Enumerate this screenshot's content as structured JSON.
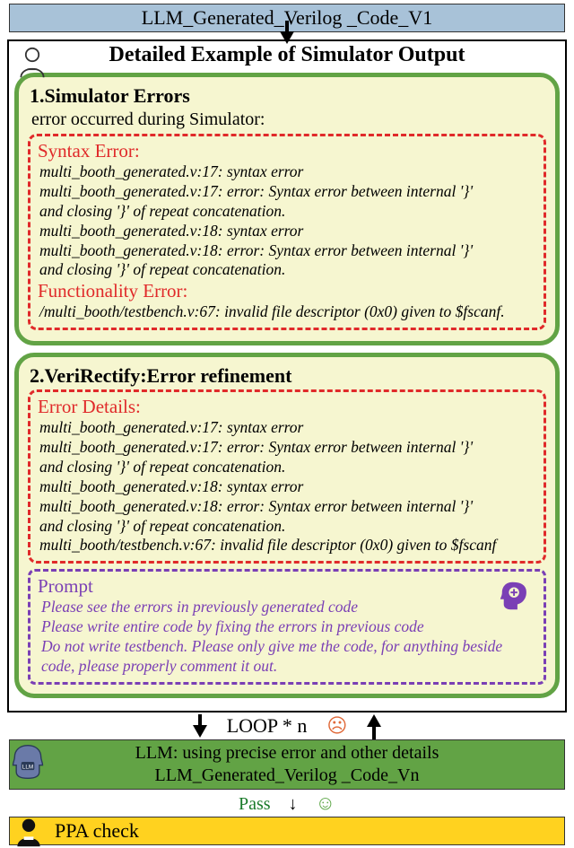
{
  "top_label": "LLM_Generated_Verilog _Code_V1",
  "main_title": "Detailed Example of Simulator Output",
  "box1": {
    "heading": "1.Simulator Errors",
    "sub": "error occurred during Simulator:",
    "syntax_label": "Syntax Error:",
    "syntax_lines": [
      "multi_booth_generated.v:17: syntax error",
      "multi_booth_generated.v:17: error: Syntax error between internal '}'",
      " and closing '}' of repeat concatenation.",
      "multi_booth_generated.v:18: syntax error",
      "multi_booth_generated.v:18: error: Syntax error between internal '}'",
      " and closing '}' of repeat concatenation."
    ],
    "func_label": "Functionality Error:",
    "func_lines": [
      "/multi_booth/testbench.v:67: invalid file descriptor (0x0) given to $fscanf."
    ]
  },
  "box2": {
    "heading": "2.VeriRectify:Error refinement",
    "details_label": "Error Details:",
    "detail_lines": [
      "multi_booth_generated.v:17: syntax error",
      "multi_booth_generated.v:17: error: Syntax error between internal '}'",
      " and closing '}' of repeat concatenation.",
      "multi_booth_generated.v:18: syntax error",
      "multi_booth_generated.v:18: error: Syntax error between internal '}'",
      " and closing '}' of repeat concatenation.",
      "multi_booth/testbench.v:67: invalid file descriptor (0x0) given to $fscanf"
    ],
    "prompt_label": "Prompt",
    "prompt_lines": [
      "Please see the errors in previously generated code",
      "Please write entire code by fixing the errors in previous code",
      "Do not write testbench. Please only give me the code, for anything beside",
      "code, please properly comment it out."
    ]
  },
  "loop_label": "LOOP * n",
  "llm_line1": "LLM: using precise error and other details",
  "llm_line2": "LLM_Generated_Verilog _Code_Vn",
  "pass_label": "Pass",
  "ppa_label": "PPA check",
  "faces": {
    "sad": "☹",
    "happy": "☺"
  }
}
